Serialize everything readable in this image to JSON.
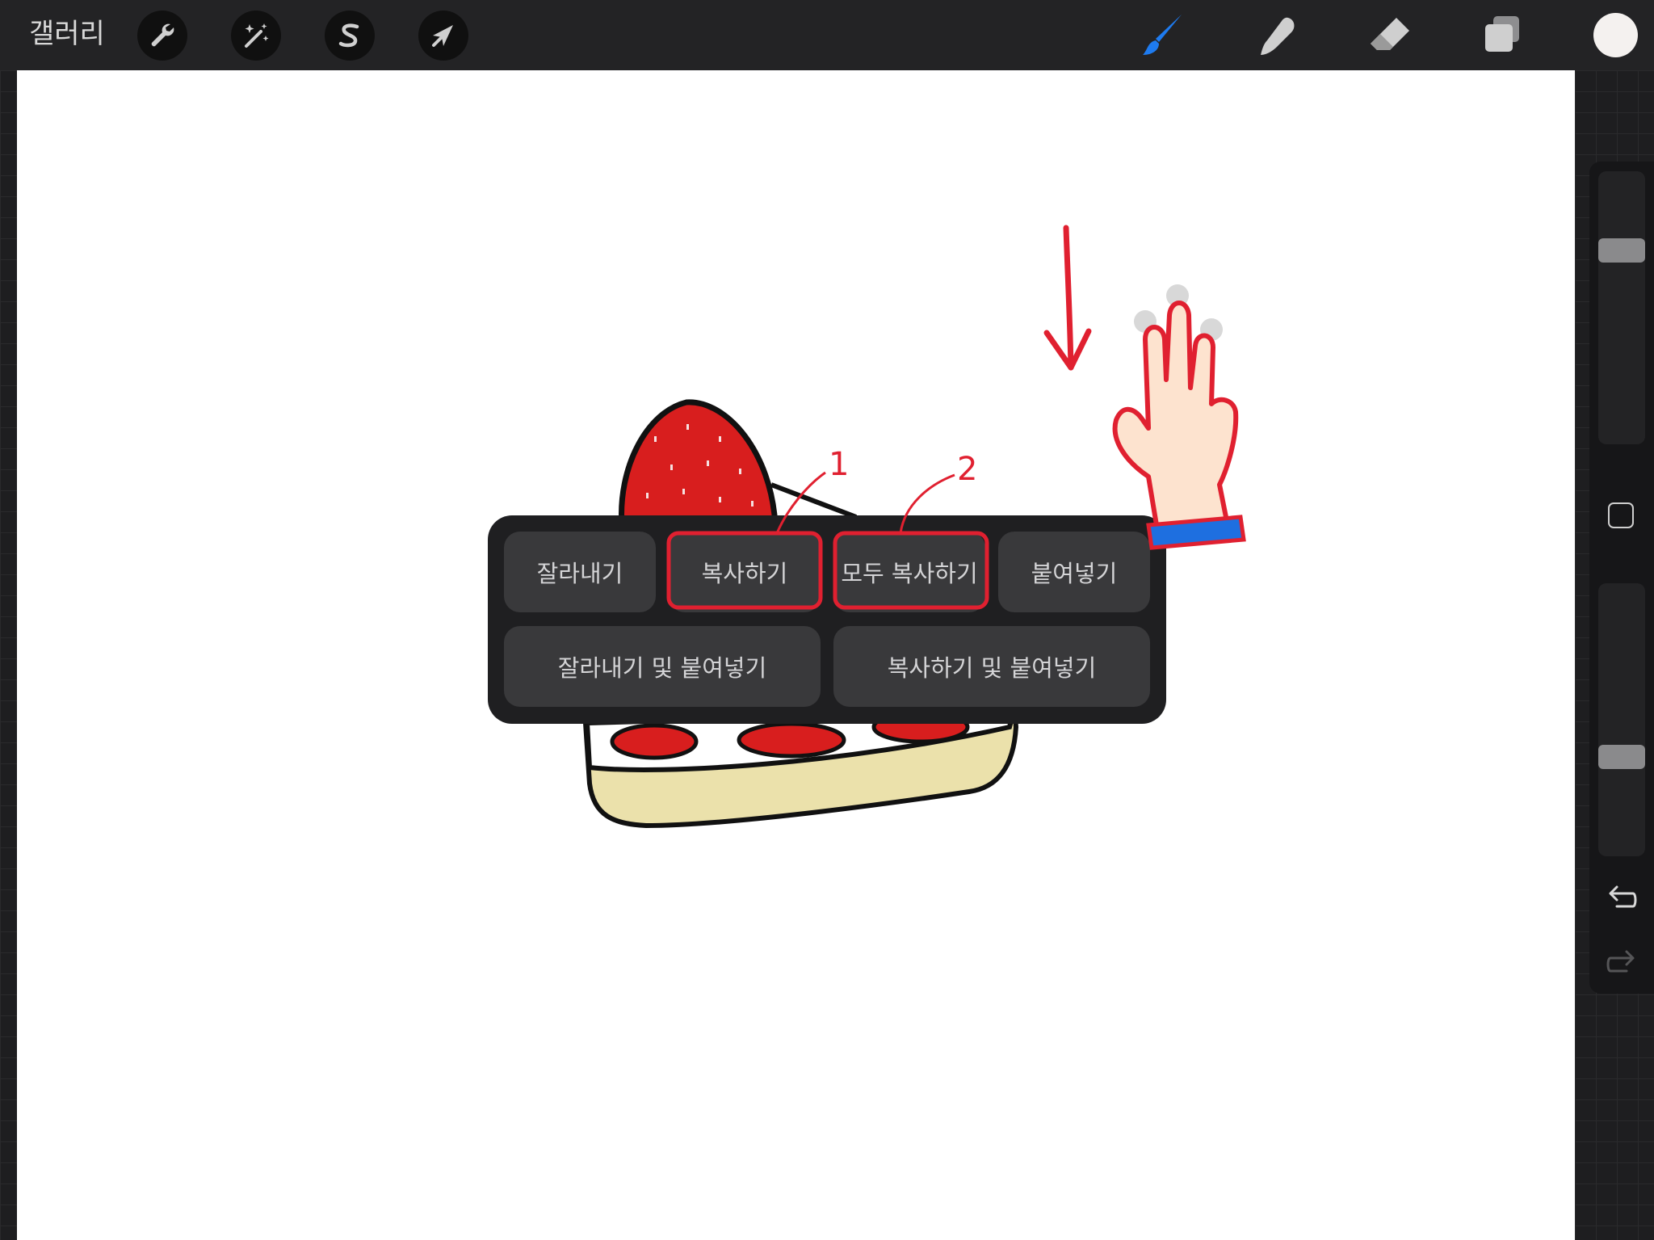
{
  "toolbar": {
    "gallery_label": "갤러리",
    "left_tools": [
      {
        "icon": "wrench-icon",
        "name": "actions"
      },
      {
        "icon": "magic-wand-icon",
        "name": "adjustments"
      },
      {
        "icon": "selection-s-icon",
        "name": "selection"
      },
      {
        "icon": "arrow-cursor-icon",
        "name": "transform"
      }
    ],
    "right_tools": [
      {
        "icon": "brush-icon",
        "name": "paint",
        "active": true
      },
      {
        "icon": "smudge-icon",
        "name": "smudge"
      },
      {
        "icon": "eraser-icon",
        "name": "eraser"
      },
      {
        "icon": "layers-icon",
        "name": "layers"
      }
    ],
    "active_color": "#1e7bf0",
    "swatch_color": "#f4f1ef"
  },
  "sidebar": {
    "brush_size_level": 0.73,
    "opacity_level": 0.35,
    "modify_icon": "square-icon",
    "undo_icon": "undo-icon",
    "redo_icon": "redo-icon"
  },
  "copy_menu": {
    "row1": {
      "cut": "잘라내기",
      "copy": "복사하기",
      "copy_all": "모두 복사하기",
      "paste": "붙여넣기"
    },
    "row2": {
      "cut_paste": "잘라내기 및 붙여넣기",
      "copy_paste": "복사하기 및 붙여넣기"
    }
  },
  "annotations": {
    "marker_1": "1",
    "marker_2": "2",
    "highlight_color": "#e02030"
  }
}
